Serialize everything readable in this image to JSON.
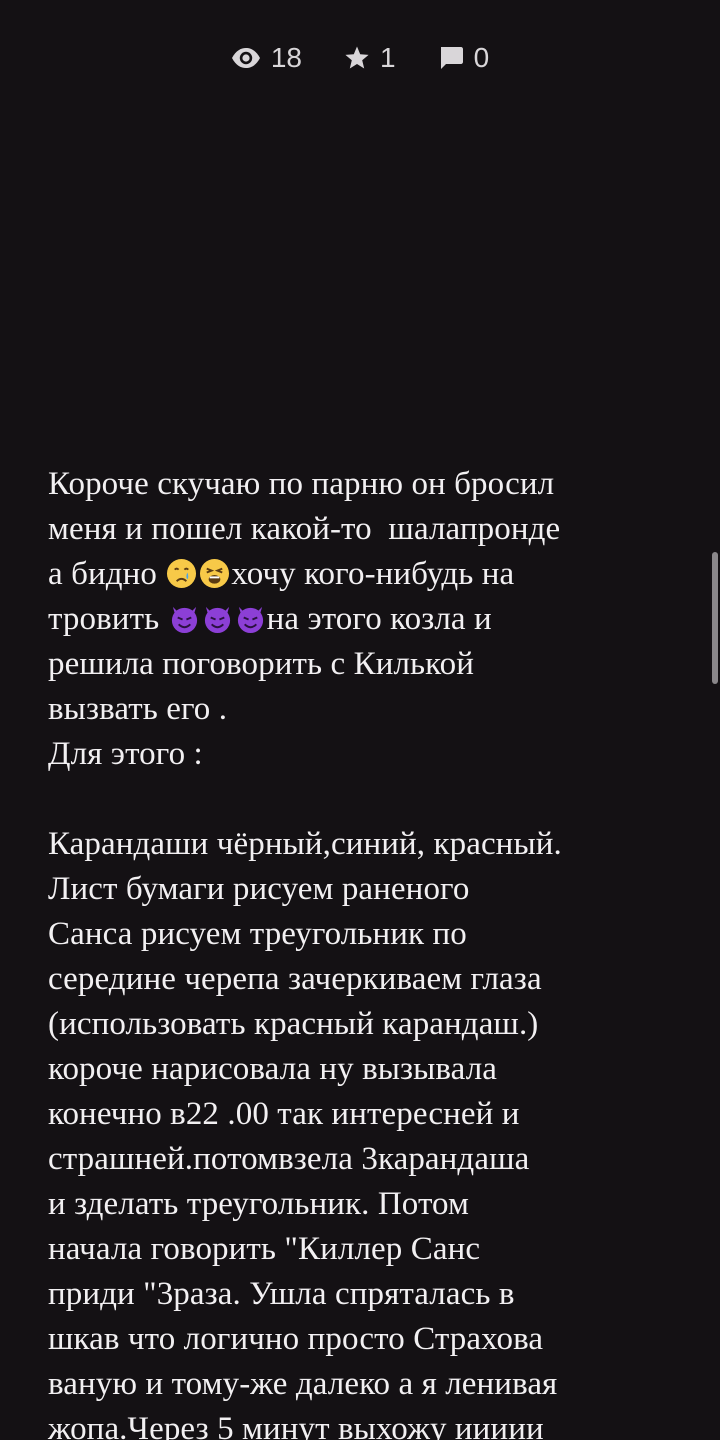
{
  "stats": {
    "views": "18",
    "likes": "1",
    "comments": "0",
    "icons": {
      "views": "eye-icon",
      "likes": "star-icon",
      "comments": "comment-icon"
    }
  },
  "story": {
    "p1": [
      "Короче скучаю по парню он бросил",
      "меня и пошел какой-то  шалапронде",
      "а бидно ",
      "хочу кого-нибудь на",
      "тровить ",
      "на этого козла и",
      "решила поговорить с Килькой",
      "вызвать его .",
      "Для этого :"
    ],
    "p2": [
      "Карандаши чёрный,синий, красный.",
      "Лист бумаги рисуем раненого",
      "Санса рисуем треугольник по",
      "середине черепа зачеркиваем глаза",
      "(использовать красный карандаш.)",
      "короче нарисовала ну вызывала",
      "конечно в22 .00 так интересней и",
      "страшней.потомвзела 3карандаша",
      "и зделать треугольник. Потом",
      "начала говорить \"Киллер Санс",
      "приди \"3раза. Ушла спряталась в",
      "шкав что логично просто Страхова",
      "ваную и тому-же далеко а я ленивая",
      "жопа.Через 5 минут выхожу иииии"
    ],
    "emoji_names": [
      "crying-face-icon",
      "weary-face-icon",
      "smiling-devil-icon"
    ]
  },
  "colors": {
    "background": "#141114",
    "text": "#f2f0f2",
    "stats_text": "#d9d6d9",
    "devil": "#8c3fd6"
  }
}
